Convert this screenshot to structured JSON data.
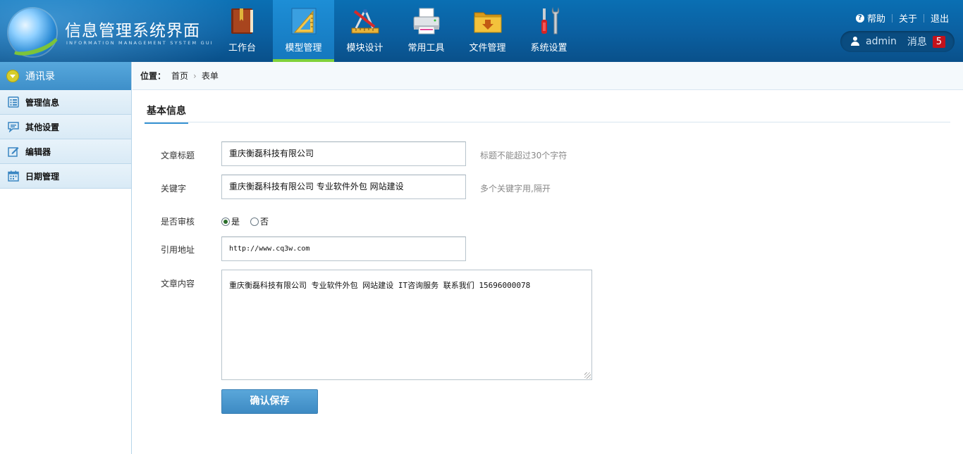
{
  "app": {
    "title": "信息管理系统界面",
    "subtitle": "INFORMATION MANAGEMENT SYSTEM GUI"
  },
  "nav": {
    "items": [
      {
        "label": "工作台",
        "icon": "book-icon"
      },
      {
        "label": "模型管理",
        "icon": "ruler-icon",
        "active": true
      },
      {
        "label": "模块设计",
        "icon": "design-tools-icon"
      },
      {
        "label": "常用工具",
        "icon": "printer-icon"
      },
      {
        "label": "文件管理",
        "icon": "folder-icon"
      },
      {
        "label": "系统设置",
        "icon": "wrench-screwdriver-icon"
      }
    ]
  },
  "toplinks": {
    "help": "帮助",
    "about": "关于",
    "logout": "退出"
  },
  "user": {
    "name": "admin",
    "messages_label": "消息",
    "messages_count": "5"
  },
  "sidebar": {
    "header": "通讯录",
    "items": [
      {
        "label": "管理信息",
        "icon": "list-icon"
      },
      {
        "label": "其他设置",
        "icon": "comment-icon"
      },
      {
        "label": "编辑器",
        "icon": "edit-icon"
      },
      {
        "label": "日期管理",
        "icon": "calendar-icon"
      }
    ]
  },
  "breadcrumb": {
    "label": "位置：",
    "home": "首页",
    "current": "表单"
  },
  "form": {
    "section_title": "基本信息",
    "title_label": "文章标题",
    "title_value": "重庆衡磊科技有限公司",
    "title_hint": "标题不能超过30个字符",
    "keywords_label": "关键字",
    "keywords_value": "重庆衡磊科技有限公司 专业软件外包 网站建设",
    "keywords_hint": "多个关键字用,隔开",
    "review_label": "是否审核",
    "review_yes": "是",
    "review_no": "否",
    "url_label": "引用地址",
    "url_value": "http://www.cq3w.com",
    "content_label": "文章内容",
    "content_value": "重庆衡磊科技有限公司 专业软件外包 网站建设 IT咨询服务  联系我们  15696000078",
    "save_button": "确认保存"
  },
  "colors": {
    "header_bg": "#0b5fa0",
    "active_tab_underline": "#7fd13b",
    "badge": "#c4121b",
    "primary_button": "#3d8ac3"
  }
}
